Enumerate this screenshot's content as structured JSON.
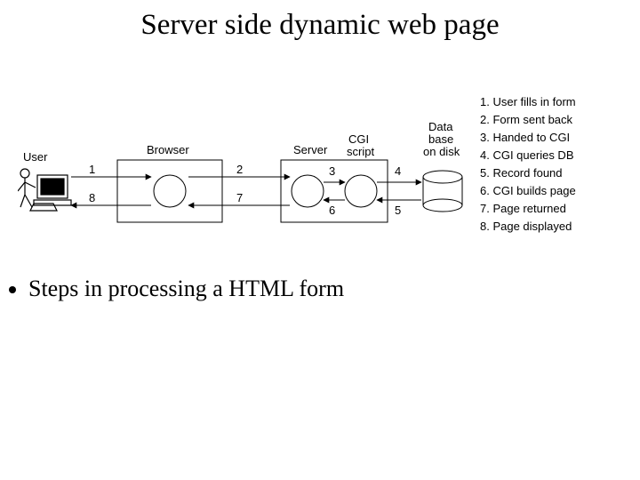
{
  "title": "Server side dynamic web page",
  "bullet": "Steps in processing a HTML form",
  "labels": {
    "user": "User",
    "browser": "Browser",
    "server": "Server",
    "cgi": "CGI\nscript",
    "db": "Data\nbase\non disk"
  },
  "arrows": {
    "a1": "1",
    "a2": "2",
    "a3": "3",
    "a4": "4",
    "a5": "5",
    "a6": "6",
    "a7": "7",
    "a8": "8"
  },
  "legend": [
    "1. User fills in form",
    "2. Form sent back",
    "3. Handed to CGI",
    "4. CGI queries DB",
    "5. Record found",
    "6. CGI builds page",
    "7. Page returned",
    "8. Page displayed"
  ]
}
